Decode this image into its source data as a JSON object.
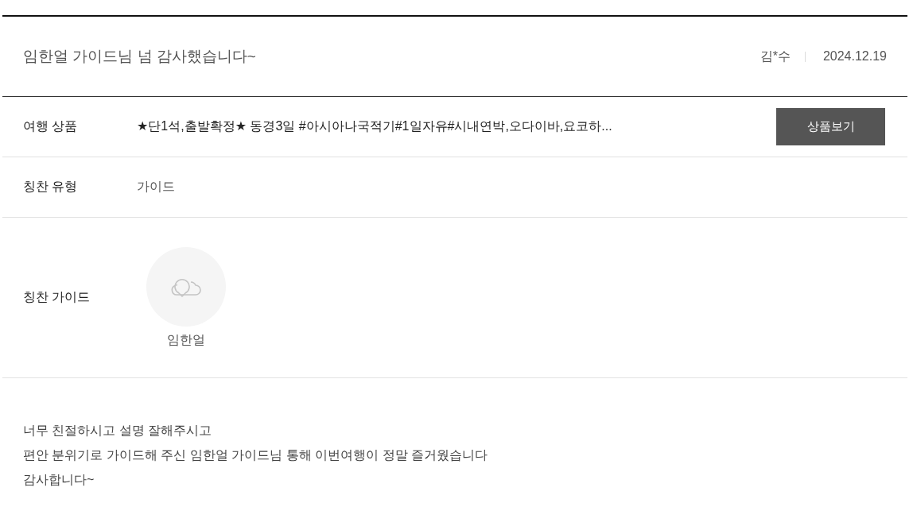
{
  "post": {
    "title": "임한얼 가이드님 넘 감사했습니다~",
    "author": "김*수",
    "date": "2024.12.19"
  },
  "details": [
    {
      "kind": "product",
      "label": "여행 상품",
      "value": "★단1석,출발확정★ 동경3일 #아시아나국적기#1일자유#시내연박,오다이바,요코하...",
      "button": "상품보기"
    },
    {
      "kind": "text",
      "label": "칭찬 유형",
      "value": "가이드"
    },
    {
      "kind": "guides",
      "label": "칭찬 가이드",
      "guides": [
        {
          "name": "임한얼"
        }
      ]
    }
  ],
  "message": "너무 친절하시고 설명 잘해주시고\n편안 분위기로 가이드해 주신 임한얼 가이드님 통해 이번여행이 정말 즐거웠습니다\n감사합니다~"
}
